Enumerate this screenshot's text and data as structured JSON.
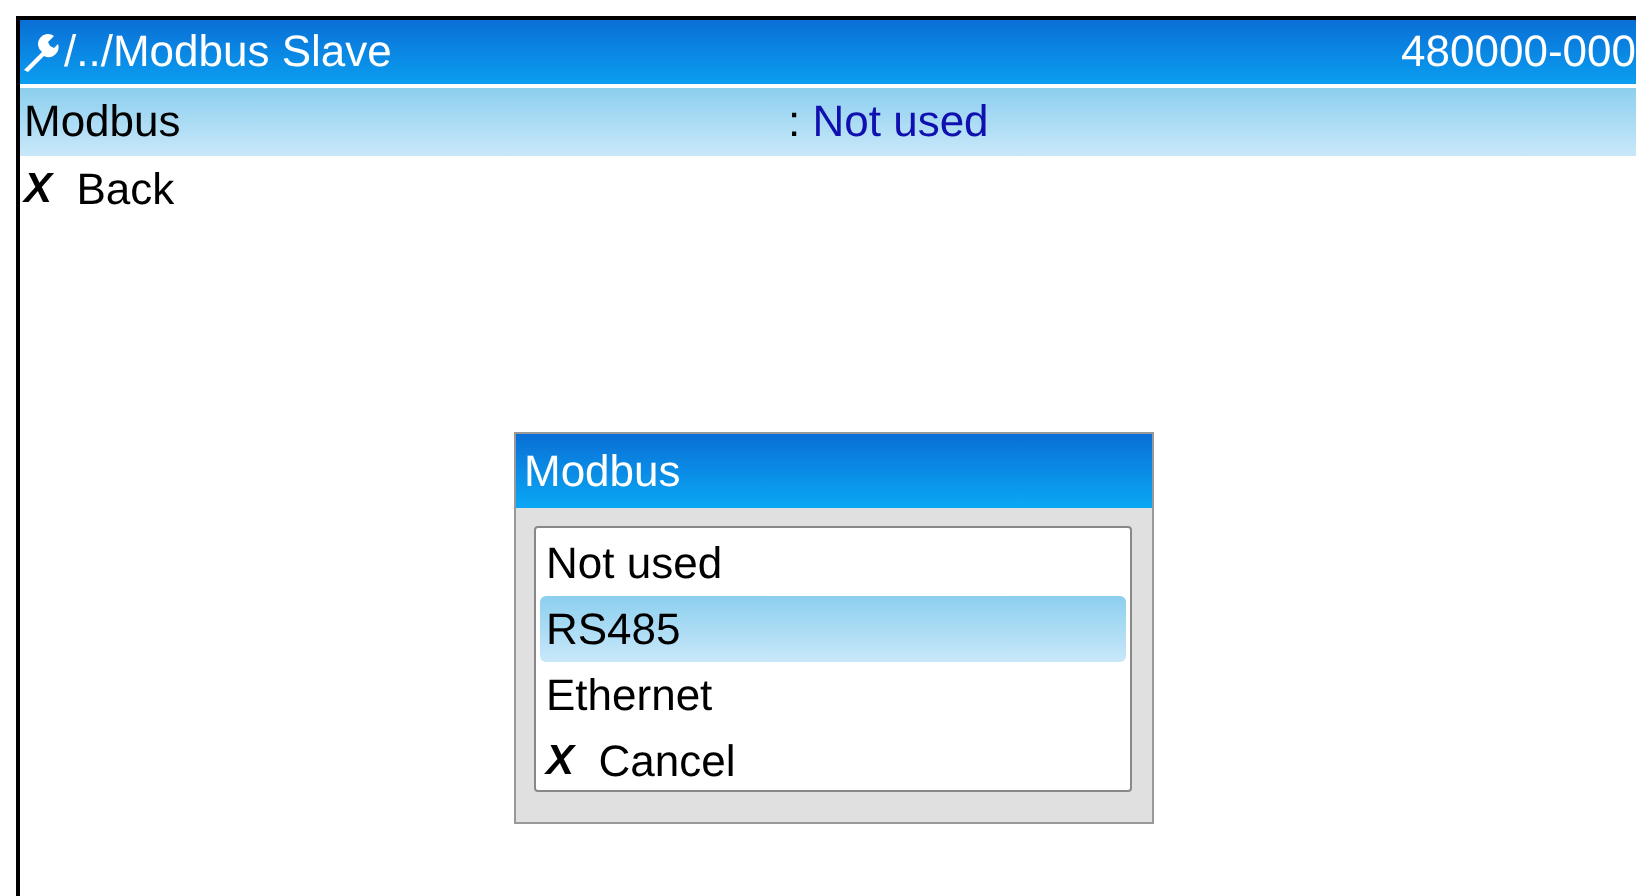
{
  "header": {
    "path": "/../Modbus Slave",
    "device": "480000-000"
  },
  "menu": [
    {
      "kind": "setting",
      "label": "Modbus",
      "separator": ":",
      "value": "Not used",
      "selected": true
    },
    {
      "kind": "action",
      "mark": "X",
      "label": "Back",
      "selected": false
    }
  ],
  "dialog": {
    "title": "Modbus",
    "options": [
      {
        "kind": "option",
        "label": "Not used",
        "selected": false
      },
      {
        "kind": "option",
        "label": "RS485",
        "selected": true
      },
      {
        "kind": "option",
        "label": "Ethernet",
        "selected": false
      },
      {
        "kind": "action",
        "mark": "X",
        "label": "Cancel",
        "selected": false
      }
    ]
  }
}
